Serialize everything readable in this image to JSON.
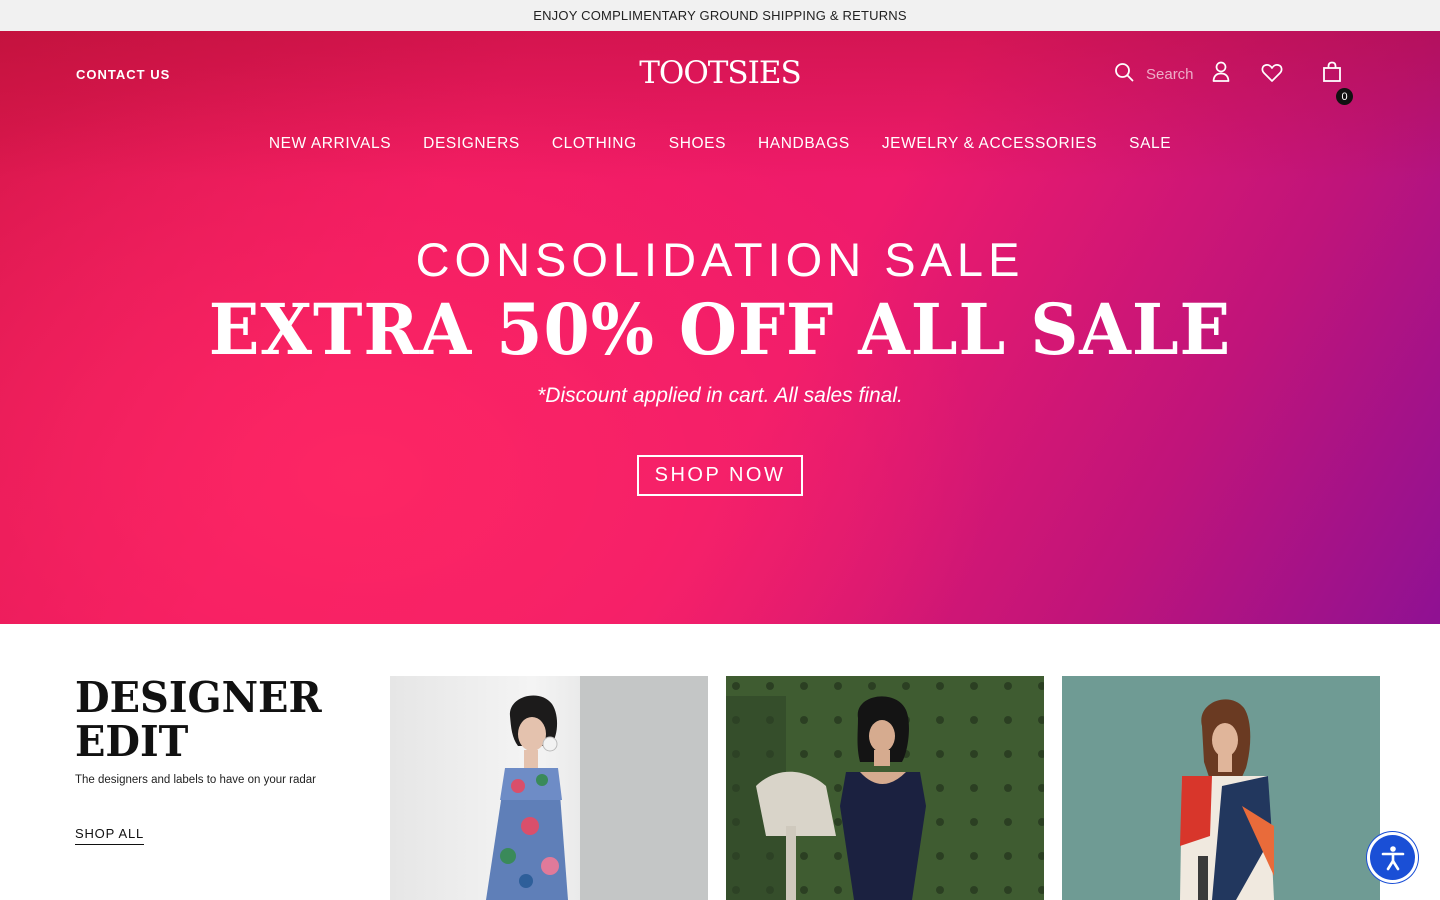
{
  "promo": {
    "text": "ENJOY COMPLIMENTARY GROUND SHIPPING & RETURNS"
  },
  "header": {
    "contact_label": "CONTACT US",
    "logo_text": "TOOTSIES",
    "search_placeholder": "Search",
    "bag_count": "0",
    "icons": [
      "search-icon",
      "account-icon",
      "heart-icon",
      "shopping-bag-icon"
    ]
  },
  "nav": {
    "items": [
      {
        "label": "NEW ARRIVALS"
      },
      {
        "label": "DESIGNERS"
      },
      {
        "label": "CLOTHING"
      },
      {
        "label": "SHOES"
      },
      {
        "label": "HANDBAGS"
      },
      {
        "label": "JEWELRY & ACCESSORIES"
      },
      {
        "label": "SALE"
      }
    ]
  },
  "hero": {
    "eyebrow": "CONSOLIDATION SALE",
    "title": "EXTRA 50% OFF ALL SALE",
    "subtitle": "*Discount applied in cart. All sales final.",
    "cta": "SHOP NOW",
    "colors": {
      "start": "#d7174a",
      "mid": "#ef1b6c",
      "end": "#8f1193"
    }
  },
  "designer_edit": {
    "title": "DESIGNER EDIT",
    "subtitle": "The designers and labels to have on your radar",
    "cta": "SHOP ALL"
  },
  "accessibility": {
    "icon": "accessibility-icon",
    "color": "#1a4fd6"
  }
}
